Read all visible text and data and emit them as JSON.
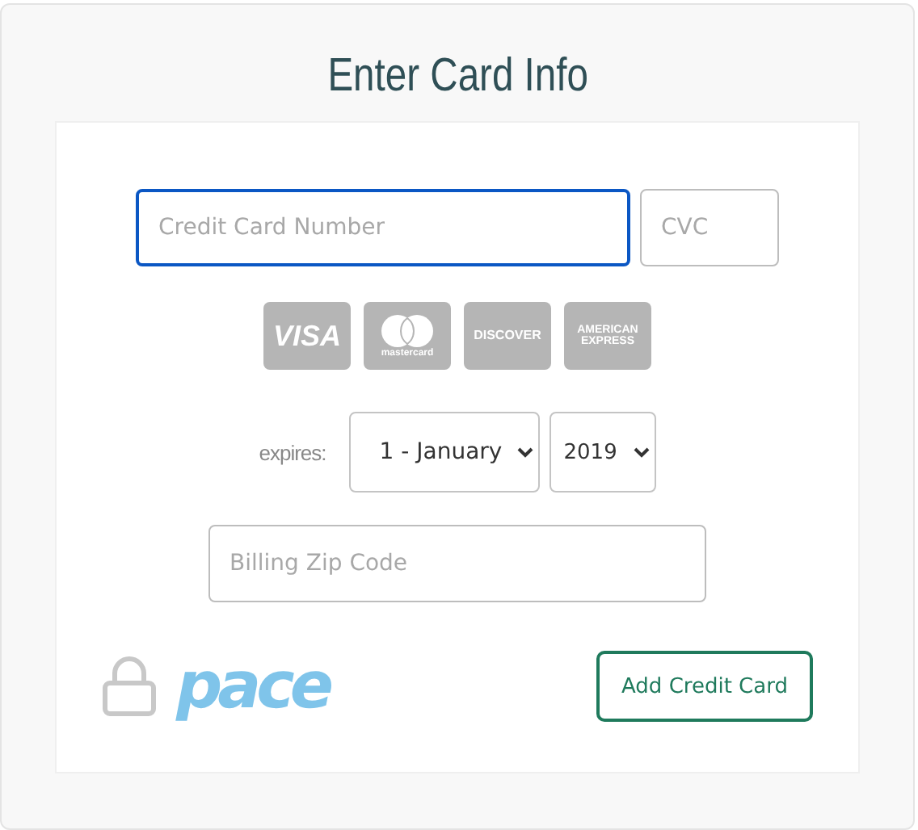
{
  "title": "Enter Card Info",
  "card_number": {
    "placeholder": "Credit Card Number",
    "focused": true
  },
  "cvc": {
    "placeholder": "CVC",
    "focused": false
  },
  "card_brands": [
    {
      "kind": "visa",
      "label": "VISA"
    },
    {
      "kind": "mastercard",
      "label": "mastercard"
    },
    {
      "kind": "discover",
      "label": "DISCOVER"
    },
    {
      "kind": "amex",
      "label": "AMERICAN EXPRESS"
    }
  ],
  "expires": {
    "label": "expires:",
    "month": "1 - January",
    "year": "2019"
  },
  "zip": {
    "placeholder": "Billing Zip Code"
  },
  "logo": {
    "text": "pace"
  },
  "submit": {
    "label": "Add Credit Card"
  }
}
